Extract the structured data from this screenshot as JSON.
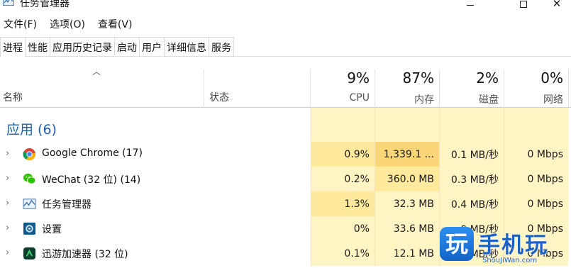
{
  "window": {
    "title": "任务管理器",
    "minimize": "minimize",
    "maximize": "maximize",
    "close": "✕"
  },
  "menu": {
    "items": [
      "文件(F)",
      "选项(O)",
      "查看(V)"
    ]
  },
  "tabs": {
    "items": [
      "进程",
      "性能",
      "应用历史记录",
      "启动",
      "用户",
      "详细信息",
      "服务"
    ],
    "active": "进程"
  },
  "columns": {
    "name": "名称",
    "status": "状态",
    "cpu": {
      "percent": "9%",
      "label": "CPU"
    },
    "memory": {
      "percent": "87%",
      "label": "内存"
    },
    "disk": {
      "percent": "2%",
      "label": "磁盘"
    },
    "network": {
      "percent": "0%",
      "label": "网络"
    }
  },
  "sections": {
    "apps_title": "应用 (6)"
  },
  "rows": [
    {
      "name": "Google Chrome (17)",
      "icon": "chrome-icon",
      "cpu": "0.9%",
      "memory": "1,339.1 ...",
      "disk": "0.1 MB/秒",
      "network": "0 Mbps"
    },
    {
      "name": "WeChat (32 位) (14)",
      "icon": "wechat-icon",
      "cpu": "0.2%",
      "memory": "360.0 MB",
      "disk": "0.3 MB/秒",
      "network": "0 Mbps"
    },
    {
      "name": "任务管理器",
      "icon": "task-manager-icon",
      "cpu": "1.3%",
      "memory": "32.3 MB",
      "disk": "0.4 MB/秒",
      "network": "0 Mbps"
    },
    {
      "name": "设置",
      "icon": "settings-icon",
      "cpu": "0%",
      "memory": "33.6 MB",
      "disk": "0 MB/秒",
      "network": "0 Mbps"
    },
    {
      "name": "迅游加速器 (32 位)",
      "icon": "xunyou-icon",
      "cpu": "0.1%",
      "memory": "12.1 MB",
      "disk": "0 MB/秒",
      "network": "0 Mbps"
    }
  ],
  "watermark": {
    "glyph": "玩",
    "text": "手机玩",
    "sub": "ShouJiWan.com"
  },
  "colors": {
    "accent": "#1f5fb4",
    "heat_light": "#fff4c4",
    "heat_mid": "#ffe99c",
    "heat_strong": "#fbd678"
  }
}
